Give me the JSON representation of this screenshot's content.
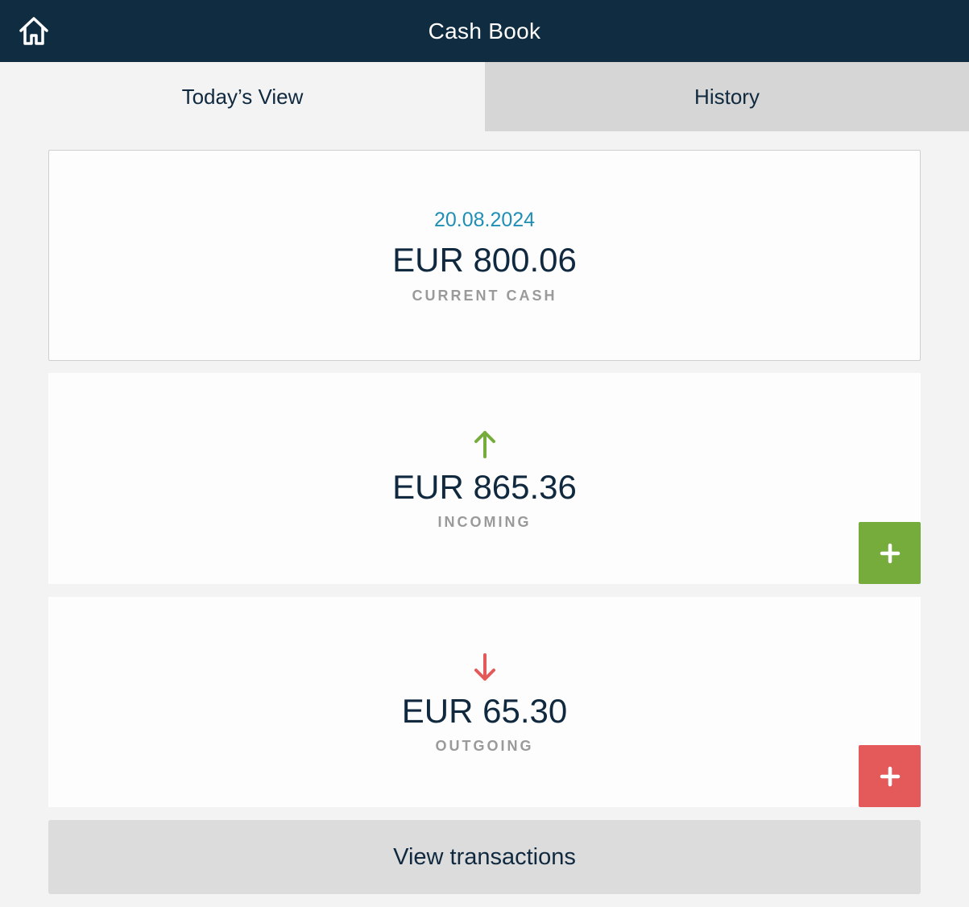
{
  "header": {
    "title": "Cash Book",
    "home_icon": "home-icon"
  },
  "tabs": [
    {
      "label": "Today’s View",
      "active": true
    },
    {
      "label": "History",
      "active": false
    }
  ],
  "current": {
    "date": "20.08.2024",
    "amount": "EUR 800.06",
    "caption": "CURRENT CASH"
  },
  "incoming": {
    "amount": "EUR 865.36",
    "caption": "INCOMING",
    "arrow_icon": "arrow-up-icon",
    "add_icon": "plus-icon",
    "color": "#76ac3c"
  },
  "outgoing": {
    "amount": "EUR 65.30",
    "caption": "OUTGOING",
    "arrow_icon": "arrow-down-icon",
    "add_icon": "plus-icon",
    "color": "#e45a5a"
  },
  "actions": {
    "view_transactions": "View transactions"
  },
  "colors": {
    "header_bg": "#0f2c40",
    "date": "#1f8fb5",
    "text": "#10293f"
  }
}
